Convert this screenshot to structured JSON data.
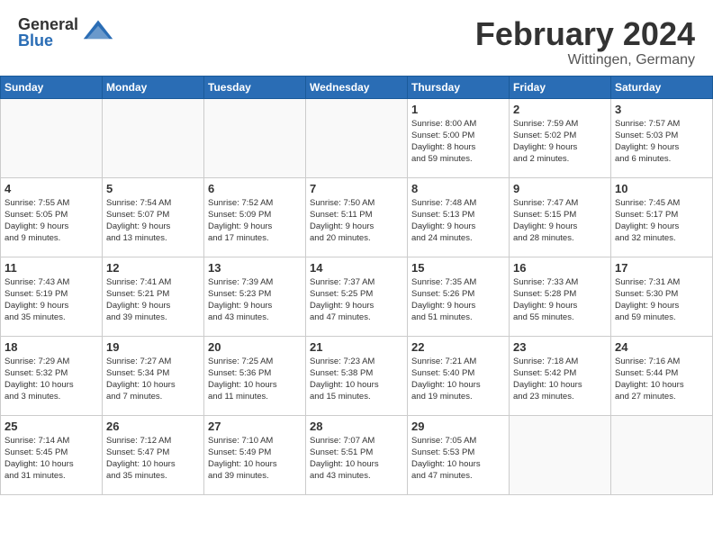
{
  "header": {
    "logo_general": "General",
    "logo_blue": "Blue",
    "month": "February 2024",
    "location": "Wittingen, Germany"
  },
  "weekdays": [
    "Sunday",
    "Monday",
    "Tuesday",
    "Wednesday",
    "Thursday",
    "Friday",
    "Saturday"
  ],
  "weeks": [
    [
      {
        "day": "",
        "info": ""
      },
      {
        "day": "",
        "info": ""
      },
      {
        "day": "",
        "info": ""
      },
      {
        "day": "",
        "info": ""
      },
      {
        "day": "1",
        "info": "Sunrise: 8:00 AM\nSunset: 5:00 PM\nDaylight: 8 hours\nand 59 minutes."
      },
      {
        "day": "2",
        "info": "Sunrise: 7:59 AM\nSunset: 5:02 PM\nDaylight: 9 hours\nand 2 minutes."
      },
      {
        "day": "3",
        "info": "Sunrise: 7:57 AM\nSunset: 5:03 PM\nDaylight: 9 hours\nand 6 minutes."
      }
    ],
    [
      {
        "day": "4",
        "info": "Sunrise: 7:55 AM\nSunset: 5:05 PM\nDaylight: 9 hours\nand 9 minutes."
      },
      {
        "day": "5",
        "info": "Sunrise: 7:54 AM\nSunset: 5:07 PM\nDaylight: 9 hours\nand 13 minutes."
      },
      {
        "day": "6",
        "info": "Sunrise: 7:52 AM\nSunset: 5:09 PM\nDaylight: 9 hours\nand 17 minutes."
      },
      {
        "day": "7",
        "info": "Sunrise: 7:50 AM\nSunset: 5:11 PM\nDaylight: 9 hours\nand 20 minutes."
      },
      {
        "day": "8",
        "info": "Sunrise: 7:48 AM\nSunset: 5:13 PM\nDaylight: 9 hours\nand 24 minutes."
      },
      {
        "day": "9",
        "info": "Sunrise: 7:47 AM\nSunset: 5:15 PM\nDaylight: 9 hours\nand 28 minutes."
      },
      {
        "day": "10",
        "info": "Sunrise: 7:45 AM\nSunset: 5:17 PM\nDaylight: 9 hours\nand 32 minutes."
      }
    ],
    [
      {
        "day": "11",
        "info": "Sunrise: 7:43 AM\nSunset: 5:19 PM\nDaylight: 9 hours\nand 35 minutes."
      },
      {
        "day": "12",
        "info": "Sunrise: 7:41 AM\nSunset: 5:21 PM\nDaylight: 9 hours\nand 39 minutes."
      },
      {
        "day": "13",
        "info": "Sunrise: 7:39 AM\nSunset: 5:23 PM\nDaylight: 9 hours\nand 43 minutes."
      },
      {
        "day": "14",
        "info": "Sunrise: 7:37 AM\nSunset: 5:25 PM\nDaylight: 9 hours\nand 47 minutes."
      },
      {
        "day": "15",
        "info": "Sunrise: 7:35 AM\nSunset: 5:26 PM\nDaylight: 9 hours\nand 51 minutes."
      },
      {
        "day": "16",
        "info": "Sunrise: 7:33 AM\nSunset: 5:28 PM\nDaylight: 9 hours\nand 55 minutes."
      },
      {
        "day": "17",
        "info": "Sunrise: 7:31 AM\nSunset: 5:30 PM\nDaylight: 9 hours\nand 59 minutes."
      }
    ],
    [
      {
        "day": "18",
        "info": "Sunrise: 7:29 AM\nSunset: 5:32 PM\nDaylight: 10 hours\nand 3 minutes."
      },
      {
        "day": "19",
        "info": "Sunrise: 7:27 AM\nSunset: 5:34 PM\nDaylight: 10 hours\nand 7 minutes."
      },
      {
        "day": "20",
        "info": "Sunrise: 7:25 AM\nSunset: 5:36 PM\nDaylight: 10 hours\nand 11 minutes."
      },
      {
        "day": "21",
        "info": "Sunrise: 7:23 AM\nSunset: 5:38 PM\nDaylight: 10 hours\nand 15 minutes."
      },
      {
        "day": "22",
        "info": "Sunrise: 7:21 AM\nSunset: 5:40 PM\nDaylight: 10 hours\nand 19 minutes."
      },
      {
        "day": "23",
        "info": "Sunrise: 7:18 AM\nSunset: 5:42 PM\nDaylight: 10 hours\nand 23 minutes."
      },
      {
        "day": "24",
        "info": "Sunrise: 7:16 AM\nSunset: 5:44 PM\nDaylight: 10 hours\nand 27 minutes."
      }
    ],
    [
      {
        "day": "25",
        "info": "Sunrise: 7:14 AM\nSunset: 5:45 PM\nDaylight: 10 hours\nand 31 minutes."
      },
      {
        "day": "26",
        "info": "Sunrise: 7:12 AM\nSunset: 5:47 PM\nDaylight: 10 hours\nand 35 minutes."
      },
      {
        "day": "27",
        "info": "Sunrise: 7:10 AM\nSunset: 5:49 PM\nDaylight: 10 hours\nand 39 minutes."
      },
      {
        "day": "28",
        "info": "Sunrise: 7:07 AM\nSunset: 5:51 PM\nDaylight: 10 hours\nand 43 minutes."
      },
      {
        "day": "29",
        "info": "Sunrise: 7:05 AM\nSunset: 5:53 PM\nDaylight: 10 hours\nand 47 minutes."
      },
      {
        "day": "",
        "info": ""
      },
      {
        "day": "",
        "info": ""
      }
    ]
  ]
}
